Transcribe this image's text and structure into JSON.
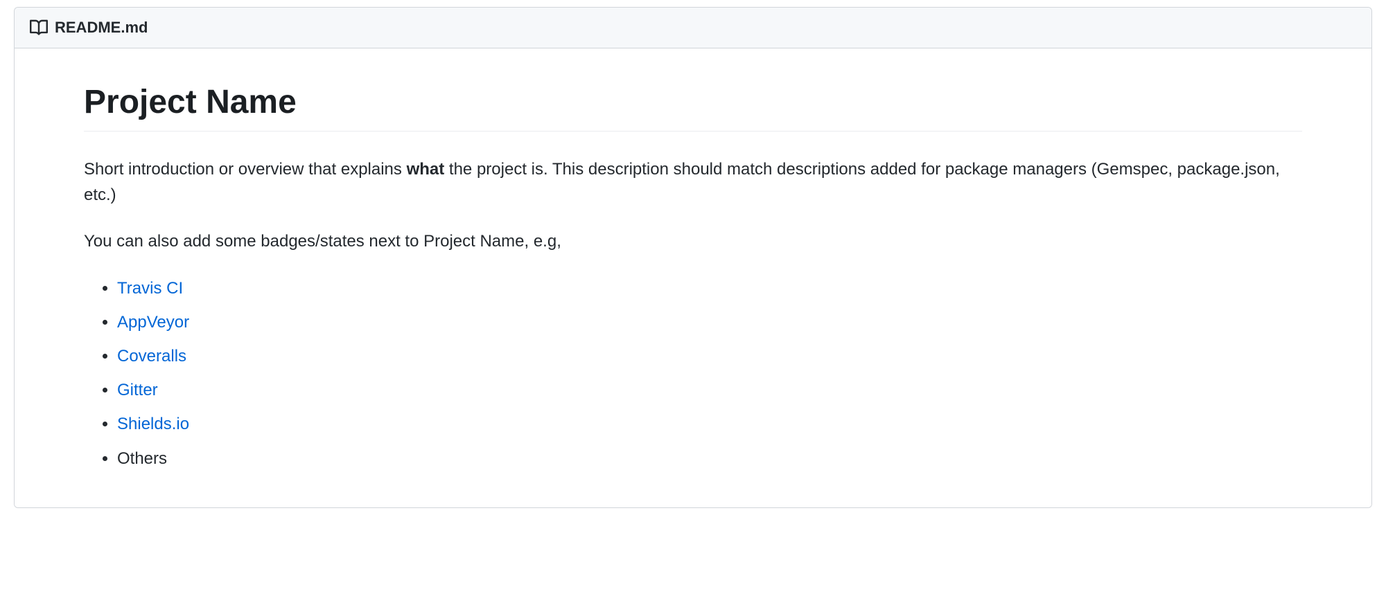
{
  "header": {
    "filename": "README.md"
  },
  "content": {
    "title": "Project Name",
    "intro_part1": "Short introduction or overview that explains ",
    "intro_bold": "what",
    "intro_part2": " the project is. This description should match descriptions added for package managers (Gemspec, package.json, etc.)",
    "badges_intro": "You can also add some badges/states next to Project Name, e.g,",
    "badges": [
      {
        "label": "Travis CI",
        "link": true
      },
      {
        "label": "AppVeyor",
        "link": true
      },
      {
        "label": "Coveralls",
        "link": true
      },
      {
        "label": "Gitter",
        "link": true
      },
      {
        "label": "Shields.io",
        "link": true
      },
      {
        "label": "Others",
        "link": false
      }
    ]
  }
}
